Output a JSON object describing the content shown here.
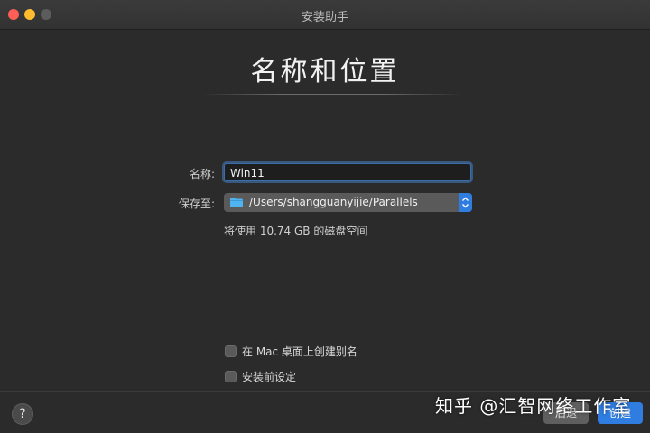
{
  "window": {
    "title": "安装助手"
  },
  "page": {
    "title": "名称和位置"
  },
  "form": {
    "name_label": "名称:",
    "name_value": "Win11",
    "location_label": "保存至:",
    "location_value": "/Users/shangguanyijie/Parallels",
    "disk_info": "将使用 10.74 GB 的磁盘空间"
  },
  "options": [
    {
      "label": "在 Mac 桌面上创建别名",
      "checked": false
    },
    {
      "label": "安装前设定",
      "checked": false
    }
  ],
  "footer": {
    "help_label": "?",
    "back_label": "后退",
    "create_label": "创建"
  },
  "watermark": {
    "text": "知乎 @汇智网络工作室"
  },
  "colors": {
    "accent": "#2f7de1",
    "background": "#2b2b2b",
    "folder": "#4fb3f0"
  }
}
